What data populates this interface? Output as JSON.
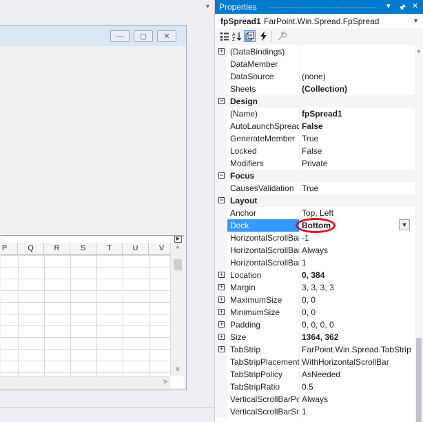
{
  "properties_window": {
    "title": "Properties",
    "title_buttons": [
      "▾",
      "🖈",
      "✕"
    ],
    "object_name": "fpSpread1",
    "object_type": "FarPoint.Win.Spread.FpSpread"
  },
  "spreadsheet": {
    "column_headers": [
      "P",
      "Q",
      "R",
      "S",
      "T",
      "U",
      "V"
    ]
  },
  "property_rows": [
    {
      "kind": "prop",
      "expandable": true,
      "name": "(DataBindings)",
      "value": "",
      "bold": false
    },
    {
      "kind": "prop",
      "expandable": false,
      "name": "DataMember",
      "value": "",
      "bold": false
    },
    {
      "kind": "prop",
      "expandable": false,
      "name": "DataSource",
      "value": "(none)",
      "bold": false
    },
    {
      "kind": "prop",
      "expandable": false,
      "name": "Sheets",
      "value": "(Collection)",
      "bold": true
    },
    {
      "kind": "category",
      "name": "Design"
    },
    {
      "kind": "prop",
      "expandable": false,
      "name": "(Name)",
      "value": "fpSpread1",
      "bold": true
    },
    {
      "kind": "prop",
      "expandable": false,
      "name": "AutoLaunchSpread",
      "value": "False",
      "bold": true
    },
    {
      "kind": "prop",
      "expandable": false,
      "name": "GenerateMember",
      "value": "True",
      "bold": false
    },
    {
      "kind": "prop",
      "expandable": false,
      "name": "Locked",
      "value": "False",
      "bold": false
    },
    {
      "kind": "prop",
      "expandable": false,
      "name": "Modifiers",
      "value": "Private",
      "bold": false
    },
    {
      "kind": "category",
      "name": "Focus"
    },
    {
      "kind": "prop",
      "expandable": false,
      "name": "CausesValidation",
      "value": "True",
      "bold": false
    },
    {
      "kind": "category",
      "name": "Layout"
    },
    {
      "kind": "prop",
      "expandable": false,
      "name": "Anchor",
      "value": "Top, Left",
      "bold": false
    },
    {
      "kind": "prop",
      "expandable": false,
      "name": "Dock",
      "value": "Bottom",
      "bold": true,
      "selected": true
    },
    {
      "kind": "prop",
      "expandable": false,
      "name": "HorizontalScrollBar",
      "value": "-1",
      "bold": false
    },
    {
      "kind": "prop",
      "expandable": false,
      "name": "HorizontalScrollBar",
      "value": "Always",
      "bold": false
    },
    {
      "kind": "prop",
      "expandable": false,
      "name": "HorizontalScrollBar",
      "value": "1",
      "bold": false
    },
    {
      "kind": "prop",
      "expandable": true,
      "name": "Location",
      "value": "0, 384",
      "bold": true
    },
    {
      "kind": "prop",
      "expandable": true,
      "name": "Margin",
      "value": "3, 3, 3, 3",
      "bold": false
    },
    {
      "kind": "prop",
      "expandable": true,
      "name": "MaximumSize",
      "value": "0, 0",
      "bold": false
    },
    {
      "kind": "prop",
      "expandable": true,
      "name": "MinimumSize",
      "value": "0, 0",
      "bold": false
    },
    {
      "kind": "prop",
      "expandable": true,
      "name": "Padding",
      "value": "0, 0, 0, 0",
      "bold": false
    },
    {
      "kind": "prop",
      "expandable": true,
      "name": "Size",
      "value": "1364, 362",
      "bold": true
    },
    {
      "kind": "prop",
      "expandable": true,
      "name": "TabStrip",
      "value": "FarPoint.Win.Spread.TabStrip",
      "bold": false
    },
    {
      "kind": "prop",
      "expandable": false,
      "name": "TabStripPlacement",
      "value": "WithHorizontalScrollBar",
      "bold": false
    },
    {
      "kind": "prop",
      "expandable": false,
      "name": "TabStripPolicy",
      "value": "AsNeeded",
      "bold": false
    },
    {
      "kind": "prop",
      "expandable": false,
      "name": "TabStripRatio",
      "value": "0.5",
      "bold": false
    },
    {
      "kind": "prop",
      "expandable": false,
      "name": "VerticalScrollBarPol",
      "value": "Always",
      "bold": false
    },
    {
      "kind": "prop",
      "expandable": false,
      "name": "VerticalScrollBarSm",
      "value": "1",
      "bold": false
    }
  ],
  "colors": {
    "accent": "#007acc",
    "selection": "#3399ff",
    "annotation": "#e4101b"
  },
  "icons": {
    "categorized": "categorized-icon",
    "alphabetical": "alphabetical-icon",
    "properties": "properties-icon",
    "events": "events-icon",
    "property_pages": "wrench-icon"
  }
}
